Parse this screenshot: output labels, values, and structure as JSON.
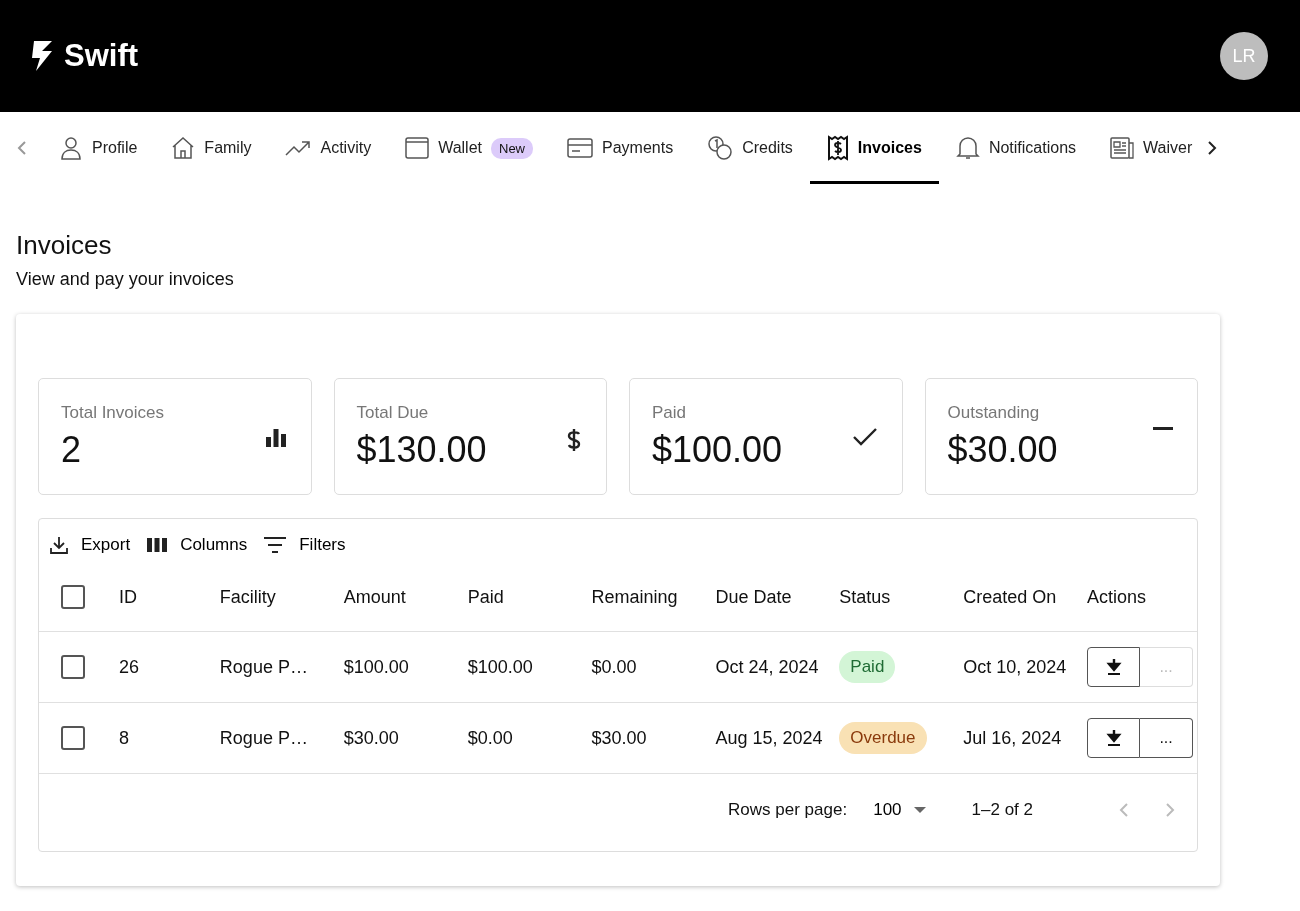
{
  "header": {
    "logo": "Swift",
    "avatar": "LR"
  },
  "tabs": [
    {
      "label": "Profile",
      "selected": false
    },
    {
      "label": "Family",
      "selected": false
    },
    {
      "label": "Activity",
      "selected": false
    },
    {
      "label": "Wallet",
      "badge": "New",
      "selected": false
    },
    {
      "label": "Payments",
      "selected": false
    },
    {
      "label": "Credits",
      "selected": false
    },
    {
      "label": "Invoices",
      "selected": true
    },
    {
      "label": "Notifications",
      "selected": false
    },
    {
      "label": "Waiver",
      "selected": false
    }
  ],
  "page": {
    "title": "Invoices",
    "subtitle": "View and pay your invoices"
  },
  "stats": [
    {
      "label": "Total Invoices",
      "value": "2",
      "kind": "chart"
    },
    {
      "label": "Total Due",
      "value": "$130.00",
      "kind": "dollar"
    },
    {
      "label": "Paid",
      "value": "$100.00",
      "kind": "check"
    },
    {
      "label": "Outstanding",
      "value": "$30.00",
      "kind": "minus"
    }
  ],
  "toolbar": [
    {
      "label": "Export",
      "kind": "export"
    },
    {
      "label": "Columns",
      "kind": "columns"
    },
    {
      "label": "Filters",
      "kind": "filters"
    }
  ],
  "table": {
    "columns": [
      "ID",
      "Facility",
      "Amount",
      "Paid",
      "Remaining",
      "Due Date",
      "Status",
      "Created On",
      "Actions"
    ],
    "all_checked": false,
    "rows": [
      {
        "checked": false,
        "id": "26",
        "facility": "Rogue P…",
        "amount": "$100.00",
        "paid": "$100.00",
        "remaining": "$0.00",
        "due": "Oct 24, 2024",
        "status": "Paid",
        "color": "#d3f5d6",
        "created": "Oct 10, 2024",
        "more": "...",
        "more_disabled": true
      },
      {
        "checked": false,
        "id": "8",
        "facility": "Rogue P…",
        "amount": "$30.00",
        "paid": "$0.00",
        "remaining": "$30.00",
        "due": "Aug 15, 2024",
        "status": "Overdue",
        "color": "#f9e1b4",
        "created": "Jul 16, 2024",
        "more": "...",
        "more_disabled": false
      }
    ]
  },
  "pagination": {
    "rows_label": "Rows per page:",
    "rows_value": "100",
    "range": "1–2 of 2",
    "prev_disabled": true,
    "next_disabled": true
  }
}
